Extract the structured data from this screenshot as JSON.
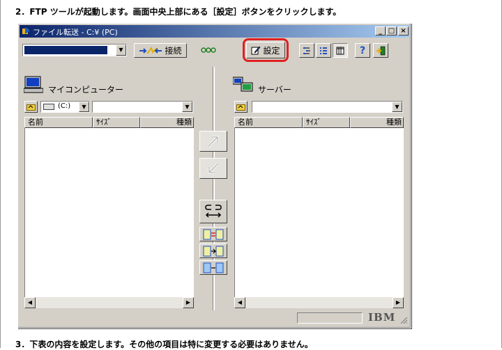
{
  "steps": {
    "step2": "2．FTP ツールが起動します。画面中央上部にある［設定］ボタンをクリックします。",
    "step3": "3．下表の内容を設定します。その他の項目は特に変更する必要はありません。"
  },
  "window": {
    "title": "ファイル転送 - C:¥ (PC)",
    "min": "_",
    "max": "□",
    "close": "×"
  },
  "toolbar": {
    "connect_label": "接続",
    "settings_label": "設定"
  },
  "local": {
    "title": "マイコンピューター",
    "drive": "(C:)",
    "columns": [
      "名前",
      "ｻｲｽﾞ",
      "種類"
    ]
  },
  "remote": {
    "title": "サーバー",
    "columns": [
      "名前",
      "ｻｲｽﾞ",
      "種類"
    ]
  },
  "status": {
    "brand": "IBM"
  },
  "colors": {
    "highlight": "#e02020",
    "titlebar": "#0a246a",
    "face": "#d4d0c8"
  }
}
